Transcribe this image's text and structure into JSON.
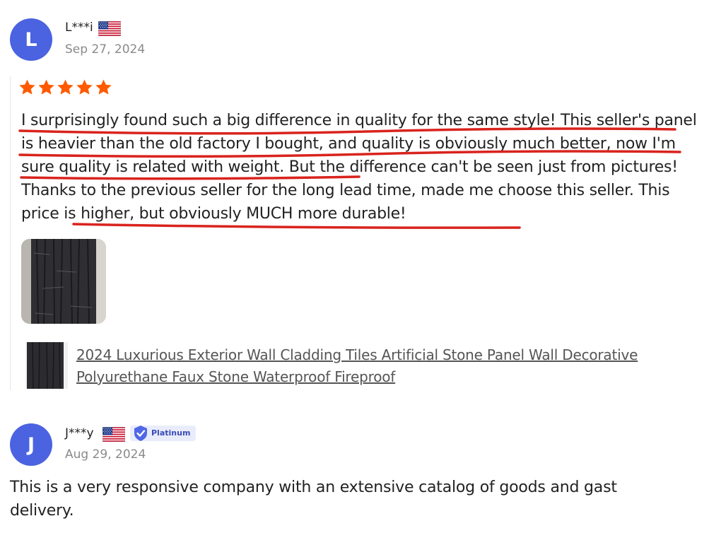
{
  "colors": {
    "avatar": "#4b63e0",
    "star": "#ff5a00",
    "underline": "#d9231d",
    "badge_bg": "#e9edfb",
    "badge_text": "#3a4bb8"
  },
  "reviews": [
    {
      "avatar_letter": "L",
      "username": "L***i",
      "flag_icon": "us-flag-icon",
      "date": "Sep 27, 2024",
      "rating": 5,
      "text_parts": [
        "I surprisingly found such a big difference in quality for the same style! This seller's panel is heavier than the old factory I bought, and quality is obviously much better, now I'm sure quality is related with weight.",
        " But the difference can't be seen just from pictures! Thanks to the previous seller for the long lead time, made me choose this seller. ",
        "This price is higher, but obviously MUCH more durable!"
      ],
      "product_title": "2024 Luxurious Exterior Wall Cladding Tiles Artificial Stone Panel Wall Decorative Polyurethane Faux Stone Waterproof Fireproof"
    },
    {
      "avatar_letter": "J",
      "username": "J***y",
      "flag_icon": "us-flag-icon",
      "badge": "Platinum",
      "date": "Aug 29, 2024",
      "text": "This is a very responsive company with an extensive catalog of goods and gast delivery."
    }
  ]
}
